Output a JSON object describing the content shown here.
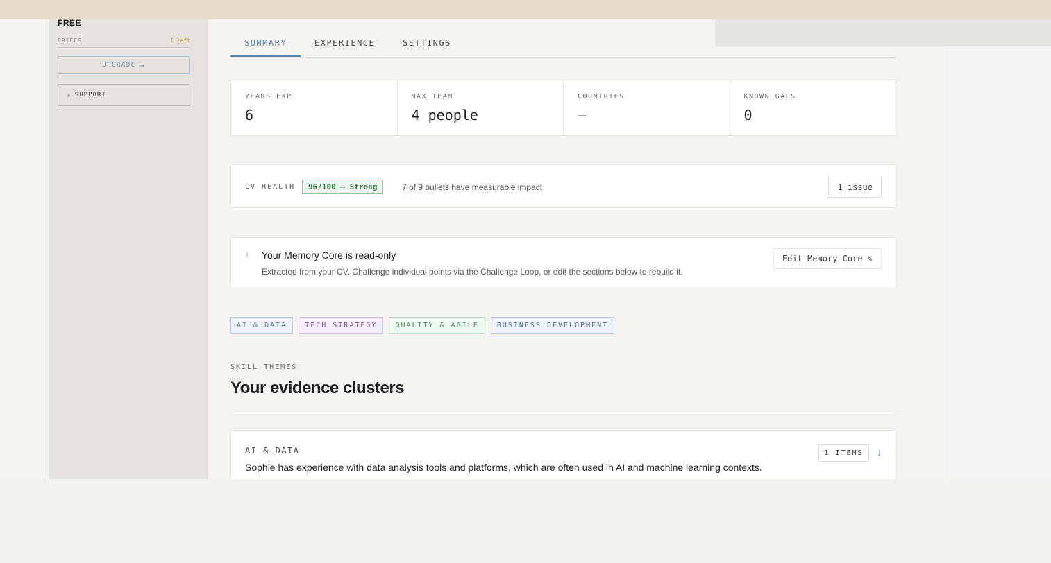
{
  "sidebar": {
    "plan": "FREE",
    "briefs_label": "BRIEFS",
    "briefs_left": "1 left",
    "upgrade_label": "UPGRADE",
    "upgrade_arrow": "⟶",
    "support_icon": "✉",
    "support_label": "SUPPORT"
  },
  "tabs": [
    {
      "label": "SUMMARY",
      "active": true
    },
    {
      "label": "EXPERIENCE",
      "active": false
    },
    {
      "label": "SETTINGS",
      "active": false
    }
  ],
  "stats": [
    {
      "label": "YEARS EXP.",
      "value": "6"
    },
    {
      "label": "MAX TEAM",
      "value": "4 people"
    },
    {
      "label": "COUNTRIES",
      "value": "—"
    },
    {
      "label": "KNOWN GAPS",
      "value": "0"
    }
  ],
  "cv_health": {
    "label": "CV HEALTH",
    "score": "96/100 — Strong",
    "description": "7 of 9 bullets have measurable impact",
    "issues": "1 issue"
  },
  "memory": {
    "icon": "i",
    "title": "Your Memory Core is read-only",
    "description": "Extracted from your CV. Challenge individual points via the Challenge Loop, or edit the sections below to rebuild it.",
    "edit_label": "Edit Memory Core ✎"
  },
  "chips": [
    {
      "label": "AI & DATA",
      "color": "#5a7fa8",
      "bg": "#eef3f9",
      "border": "#b9cde2"
    },
    {
      "label": "TECH STRATEGY",
      "color": "#7a5a9c",
      "bg": "#f4eefb",
      "border": "#d4c2ea"
    },
    {
      "label": "QUALITY & AGILE",
      "color": "#4c8a5c",
      "bg": "#eff8f1",
      "border": "#bfdfc8"
    },
    {
      "label": "BUSINESS DEVELOPMENT",
      "color": "#4f6e96",
      "bg": "#edf2f9",
      "border": "#b9cbe3"
    }
  ],
  "section": {
    "eyebrow": "SKILL THEMES",
    "title": "Your evidence clusters"
  },
  "cluster": {
    "label": "AI & DATA",
    "description": "Sophie has experience with data analysis tools and platforms, which are often used in AI and machine learning contexts.",
    "items": "1 ITEMS",
    "expand_icon": "↓"
  }
}
